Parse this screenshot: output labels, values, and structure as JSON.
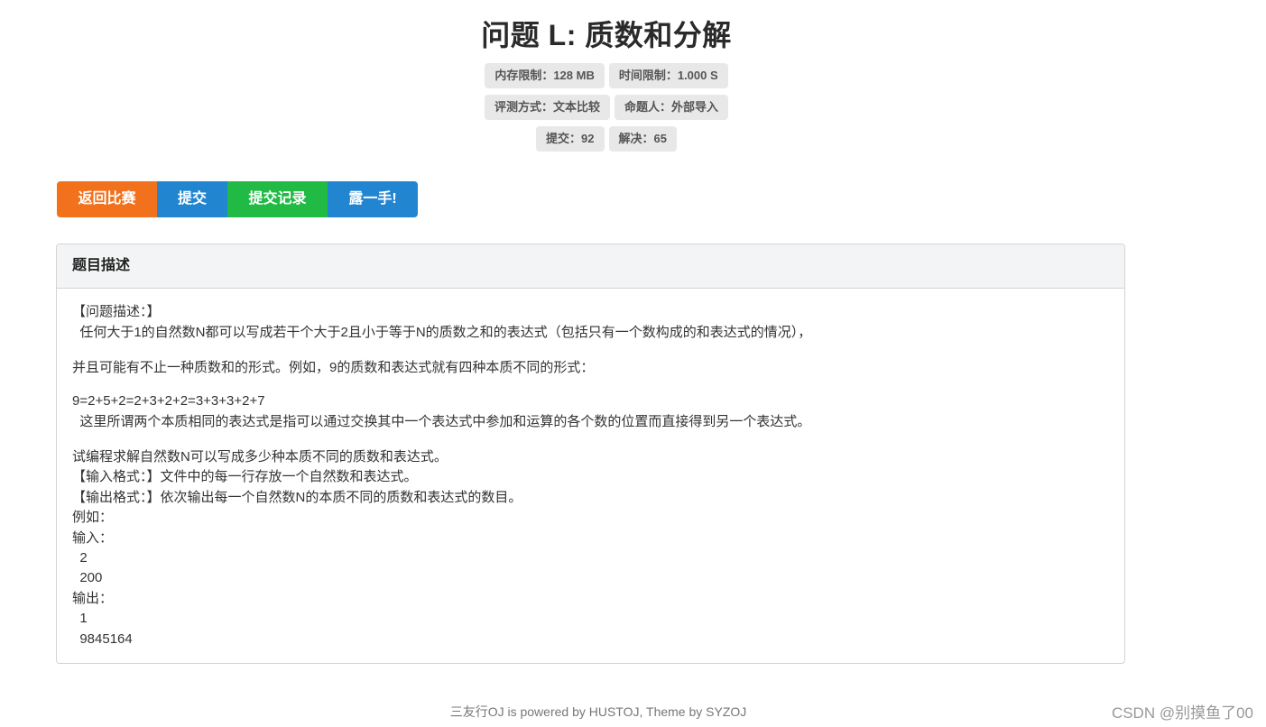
{
  "title": "问题 L: 质数和分解",
  "labels": {
    "memory": "内存限制：128 MB",
    "time": "时间限制：1.000 S",
    "judge": "评测方式：文本比较",
    "author": "命题人：外部导入",
    "submit": "提交：92",
    "solved": "解决：65"
  },
  "buttons": {
    "back": "返回比赛",
    "submit": "提交",
    "records": "提交记录",
    "show": "露一手!"
  },
  "panel": {
    "header": "题目描述",
    "lines": [
      "【问题描述：】",
      "  任何大于1的自然数N都可以写成若干个大于2且小于等于N的质数之和的表达式（包括只有一个数构成的和表达式的情况），",
      "并且可能有不止一种质数和的形式。例如，9的质数和表达式就有四种本质不同的形式：",
      "9=2+5+2=2+3+2+2=3+3+3+2+7",
      "  这里所谓两个本质相同的表达式是指可以通过交换其中一个表达式中参加和运算的各个数的位置而直接得到另一个表达式。",
      "试编程求解自然数N可以写成多少种本质不同的质数和表达式。",
      "【输入格式：】文件中的每一行存放一个自然数和表达式。",
      "【输出格式：】依次输出每一个自然数N的本质不同的质数和表达式的数目。",
      "例如：",
      "输入：",
      "  2",
      "  200",
      "输出：",
      "  1",
      "  9845164"
    ]
  },
  "footer": "三友行OJ is powered by HUSTOJ, Theme by SYZOJ",
  "watermark": "CSDN @别摸鱼了00",
  "colors": {
    "orange": "#f2711c",
    "blue": "#2185d0",
    "green": "#21ba45"
  }
}
